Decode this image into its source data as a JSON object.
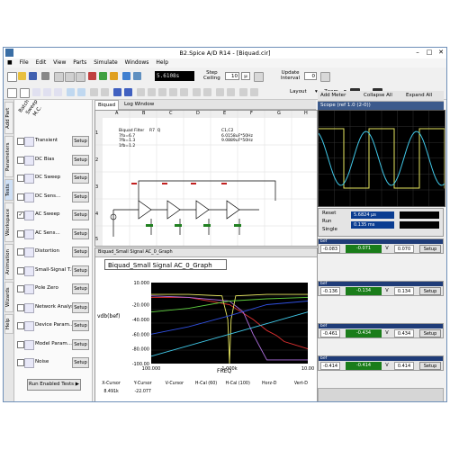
{
  "window": {
    "title": "B2.Spice A/D R14 - [Biquad.cir]",
    "controls": [
      "–",
      "□",
      "✕"
    ]
  },
  "menu": [
    "File",
    "Edit",
    "View",
    "Parts",
    "Simulate",
    "Windows",
    "Help"
  ],
  "toolbar": {
    "time_display": "5.6108s",
    "step_ceiling_label": "Step\nCeiling",
    "step_value": "10",
    "step_unit": "µ",
    "update_interval_label": "Update\nInterval",
    "update_value": "0",
    "layout_label": "Layout",
    "zoom_label": "Zoom"
  },
  "vertical_tabs": [
    "Add Part",
    "Parameters",
    "Tests",
    "Workspace",
    "Animation",
    "Wizards",
    "Help"
  ],
  "tests_header": [
    "Batch",
    "Sweep",
    "M.C."
  ],
  "tests": [
    {
      "name": "Transient",
      "checked": false,
      "setup": "Setup"
    },
    {
      "name": "DC Bias",
      "checked": false,
      "setup": "Setup"
    },
    {
      "name": "DC Sweep",
      "checked": false,
      "setup": "Setup"
    },
    {
      "name": "DC Sens...",
      "checked": false,
      "setup": "Setup"
    },
    {
      "name": "AC Sweep",
      "checked": true,
      "setup": "Setup"
    },
    {
      "name": "AC Sens...",
      "checked": false,
      "setup": "Setup"
    },
    {
      "name": "Distortion",
      "checked": false,
      "setup": "Setup"
    },
    {
      "name": "Small-Signal T.F.",
      "checked": false,
      "setup": "Setup"
    },
    {
      "name": "Pole Zero",
      "checked": false,
      "setup": "Setup"
    },
    {
      "name": "Network Analysis",
      "checked": false,
      "setup": "Setup"
    },
    {
      "name": "Device Param...",
      "checked": false,
      "setup": "Setup"
    },
    {
      "name": "Model Param...",
      "checked": false,
      "setup": "Setup"
    },
    {
      "name": "Noise",
      "checked": false,
      "setup": "Setup"
    }
  ],
  "run_button": "Run Enabled Tests",
  "schematic": {
    "tabs": [
      "Biquad",
      "Log Window"
    ],
    "columns": [
      "A",
      "B",
      "C",
      "D",
      "E",
      "F",
      "G",
      "H"
    ],
    "rows": [
      "1",
      "2",
      "3",
      "4",
      "5"
    ],
    "annotation_left": "Biquad Filter    R7  Q\n7fo=6.7\n7fb=1.3\n1fb=1.2",
    "annotation_right": "C1,C2\n6.0158uF*50Hz\n9.0889uF*50Hz"
  },
  "graph": {
    "tab": "Biquad_Small Signal AC_0_Graph",
    "title": "Biquad_Small Signal AC_0_Graph",
    "ylabel": "vdb(bef)",
    "xlabel": "FREQ",
    "yticks": [
      "-20.000",
      "-40.000",
      "-60.000",
      "-80.000",
      "-100.00"
    ],
    "ytop": "10.000",
    "xticks": [
      "100.000",
      "1.000k",
      "10.00"
    ],
    "cursor_labels": [
      "X-Cursor",
      "Y-Cursor",
      "V-Cursor",
      "H-Cal (60)",
      "H-Cal (100)",
      "Horz-D",
      "Vert-D"
    ],
    "cursor_values": [
      "8.491k",
      "-22.077",
      "",
      "",
      "",
      "",
      ""
    ]
  },
  "right_panel": {
    "tabs": [
      "Add Meter",
      "Collapse All",
      "Expand All"
    ],
    "scope_title": "Scope (ref 1.0 (2-0))",
    "reset_label": "Reset",
    "run_label": "Run",
    "single_label": "Single",
    "readouts": [
      "5.6824 µs",
      "0.135 ms"
    ],
    "meters": [
      {
        "name": "bef",
        "value": "-0.071",
        "unit": "V",
        "left": "-0.083",
        "right": "0.070",
        "setup": "Setup"
      },
      {
        "name": "bef",
        "value": "-0.134",
        "unit": "V",
        "left": "-0.136",
        "right": "0.134",
        "setup": "Setup"
      },
      {
        "name": "bef",
        "value": "-0.434",
        "unit": "V",
        "left": "-0.461",
        "right": "0.434",
        "setup": "Setup"
      },
      {
        "name": "bef",
        "value": "-0.414",
        "unit": "V",
        "left": "-0.414",
        "right": "0.414",
        "setup": "Setup"
      }
    ]
  },
  "colors": {
    "scope_bg": "#000000",
    "trace_yellow": "#e8e860",
    "trace_cyan": "#40c8e8",
    "trace_green": "#60d040",
    "trace_red": "#e03030",
    "trace_blue": "#3050e0",
    "trace_purple": "#b070e0",
    "meter_lcd": "#1a7d1a"
  },
  "chart_data": {
    "type": "line",
    "title": "Biquad_Small Signal AC_0_Graph",
    "xlabel": "FREQ",
    "ylabel": "vdb(bef)",
    "xscale": "log",
    "xlim": [
      100,
      10000
    ],
    "ylim": [
      -100,
      10
    ],
    "series": [
      {
        "x": [
          100,
          300,
          1000,
          2000,
          3000,
          4000,
          5000,
          10000
        ],
        "values": [
          -10,
          -10,
          -20,
          -40,
          -55,
          -62,
          -70,
          -80
        ]
      },
      {
        "x": [
          100,
          300,
          1000,
          1500,
          2000,
          3000,
          5000,
          10000
        ],
        "values": [
          -8,
          -10,
          -15,
          -30,
          -60,
          -95,
          -95,
          -95
        ]
      },
      {
        "x": [
          100,
          300,
          800,
          950,
          1000,
          1050,
          1200,
          3000,
          10000
        ],
        "values": [
          -6,
          -6,
          -8,
          -40,
          -100,
          -40,
          -8,
          -6,
          -6
        ]
      },
      {
        "x": [
          100,
          300,
          1000,
          3000,
          10000
        ],
        "values": [
          -30,
          -25,
          -15,
          -12,
          -10
        ]
      },
      {
        "x": [
          100,
          300,
          1000,
          3000,
          10000
        ],
        "values": [
          -60,
          -50,
          -35,
          -20,
          -15
        ]
      },
      {
        "x": [
          100,
          1000,
          10000
        ],
        "values": [
          -90,
          -60,
          -30
        ]
      }
    ]
  }
}
